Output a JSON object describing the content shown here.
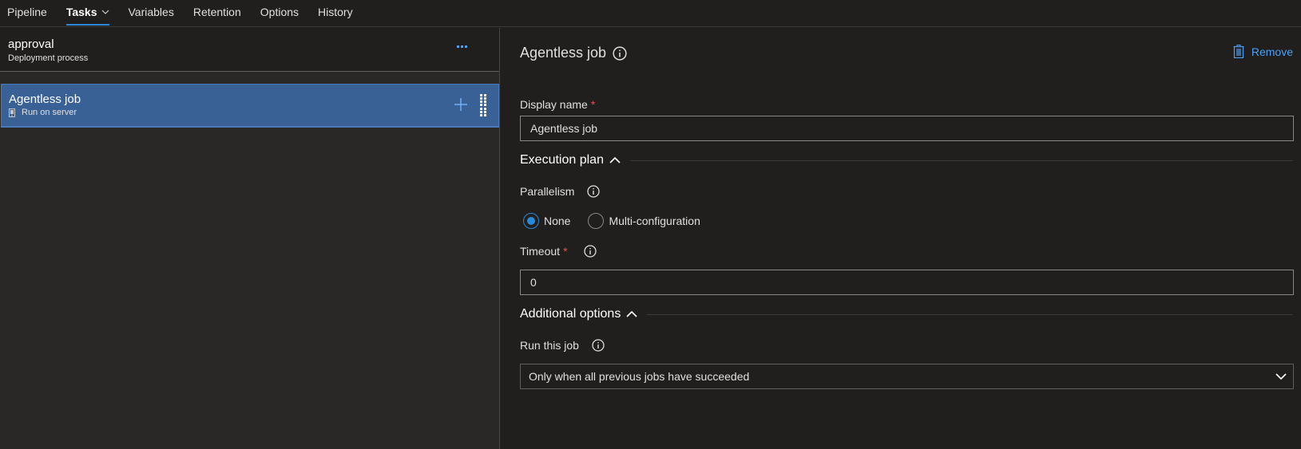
{
  "nav": {
    "tabs": [
      {
        "label": "Pipeline",
        "active": false
      },
      {
        "label": "Tasks",
        "active": true,
        "has_dropdown": true
      },
      {
        "label": "Variables",
        "active": false
      },
      {
        "label": "Retention",
        "active": false
      },
      {
        "label": "Options",
        "active": false
      },
      {
        "label": "History",
        "active": false
      }
    ]
  },
  "process": {
    "title": "approval",
    "subtitle": "Deployment process",
    "more_icon": "ellipsis-icon"
  },
  "job_list": {
    "items": [
      {
        "title": "Agentless job",
        "subtitle": "Run on server",
        "icon": "server-icon",
        "selected": true
      }
    ]
  },
  "detail": {
    "title": "Agentless job",
    "remove_label": "Remove",
    "display_name": {
      "label": "Display name",
      "required_mark": "*",
      "value": "Agentless job"
    },
    "execution_plan": {
      "header": "Execution plan",
      "parallelism": {
        "label": "Parallelism",
        "options": [
          {
            "label": "None",
            "checked": true
          },
          {
            "label": "Multi-configuration",
            "checked": false
          }
        ]
      },
      "timeout": {
        "label": "Timeout",
        "required_mark": "*",
        "value": "0"
      }
    },
    "additional_options": {
      "header": "Additional options",
      "run_this_job": {
        "label": "Run this job",
        "selected": "Only when all previous jobs have succeeded"
      }
    }
  },
  "colors": {
    "accent": "#2b88d8",
    "link": "#4e9ff5",
    "selected_item": "#3a6196",
    "required": "#e1554b",
    "background": "#201f1e"
  }
}
